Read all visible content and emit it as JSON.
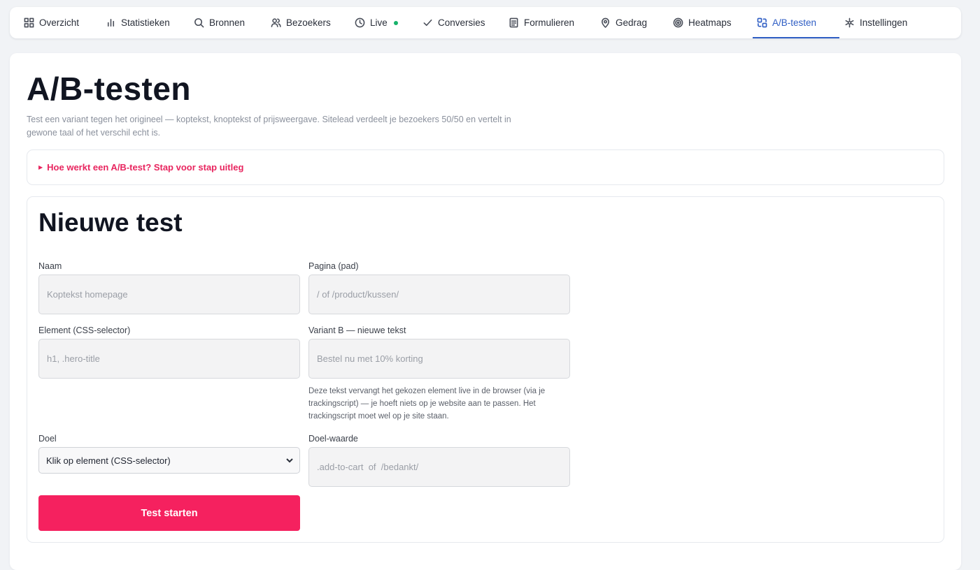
{
  "nav": {
    "tabs": [
      {
        "label": "Overzicht",
        "icon": "grid-icon"
      },
      {
        "label": "Statistieken",
        "icon": "bar-chart-icon"
      },
      {
        "label": "Bronnen",
        "icon": "search-icon"
      },
      {
        "label": "Bezoekers",
        "icon": "users-icon"
      },
      {
        "label": "Live",
        "icon": "clock-icon"
      },
      {
        "label": "Conversies",
        "icon": "check-icon"
      },
      {
        "label": "Formulieren",
        "icon": "form-icon"
      },
      {
        "label": "Gedrag",
        "icon": "map-pin-icon"
      },
      {
        "label": "Heatmaps",
        "icon": "target-icon"
      },
      {
        "label": "A/B-testen",
        "icon": "ab-test-icon"
      },
      {
        "label": "Instellingen",
        "icon": "settings-icon"
      }
    ],
    "active": "A/B-testen",
    "accent_color": "#2f5ec4",
    "live_status_color": "#17b26a"
  },
  "page": {
    "title": "A/B-testen",
    "description": "Test een variant tegen het origineel — koptekst, knoptekst of prijsweergave. Sitelead verdeelt je bezoekers 50/50 en vertelt in gewone taal of het verschil echt is.",
    "explainer": "Hoe werkt een A/B-test? Stap voor stap uitleg"
  },
  "form": {
    "title": "Nieuwe test",
    "name_label": "Naam",
    "name_placeholder": "Koptekst homepage",
    "page_label": "Pagina (pad)",
    "page_placeholder": "/ of /product/kussen/",
    "element_label": "Element (CSS-selector)",
    "element_placeholder": "h1, .hero-title",
    "variant_label": "Variant B — nieuwe tekst",
    "variant_placeholder": "Bestel nu met 10% korting",
    "variant_help": "Deze tekst vervangt het gekozen element live in de browser (via je trackingscript) — je hoeft niets op je website aan te passen. Het trackingscript moet wel op je site staan.",
    "goal_label": "Doel",
    "goal_selected": "Klik op element (CSS-selector)",
    "goal_value_label": "Doel-waarde",
    "goal_value_placeholder": ".add-to-cart  of  /bedankt/",
    "submit_label": "Test starten",
    "submit_color": "#f5215f"
  }
}
